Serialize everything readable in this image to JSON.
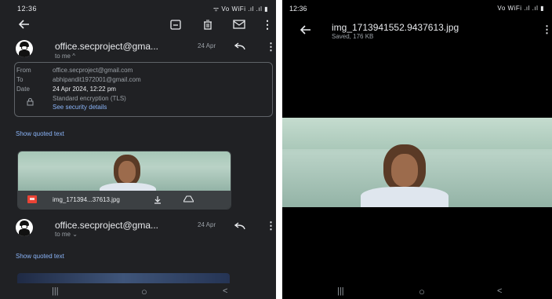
{
  "left": {
    "status": {
      "time": "12:36",
      "signal": "ᯤ Vo WiFi .ıl .ıl ▮"
    },
    "toolbar": {
      "back_icon": "arrow-left-icon",
      "archive_icon": "archive-icon",
      "delete_icon": "trash-icon",
      "mail_icon": "mail-icon",
      "more_icon": "more-vert-icon"
    },
    "message1": {
      "sender": "office.secproject@gma...",
      "date": "24 Apr",
      "to_line": "to me ^",
      "details": {
        "from_label": "From",
        "from_value": "office.secproject@gmail.com",
        "to_label": "To",
        "to_value": "abhipandit1972001@gmail.com",
        "date_label": "Date",
        "date_value": "24 Apr 2024, 12:22 pm",
        "encryption": "Standard encryption (TLS)",
        "security_link": "See security details"
      },
      "show_quoted": "Show quoted text",
      "attachment": {
        "name": "img_171394...37613.jpg"
      }
    },
    "message2": {
      "sender": "office.secproject@gma...",
      "date": "24 Apr",
      "to_line": "to me ⌄",
      "show_quoted": "Show quoted text"
    },
    "nav": {
      "recents": "|||",
      "home": "○",
      "back": "<"
    }
  },
  "right": {
    "status": {
      "time": "12:36",
      "signal": "Vo WiFi .ıl .ıl ▮"
    },
    "header": {
      "filename": "img_1713941552.9437613.jpg",
      "subtitle": "Saved, 176 KB"
    },
    "nav": {
      "recents": "|||",
      "home": "○",
      "back": "<"
    }
  },
  "colors": {
    "gmail_bg": "#202124",
    "link_blue": "#8ab4f8",
    "attachment_red": "#ea4335",
    "viewer_bg": "#000000"
  }
}
